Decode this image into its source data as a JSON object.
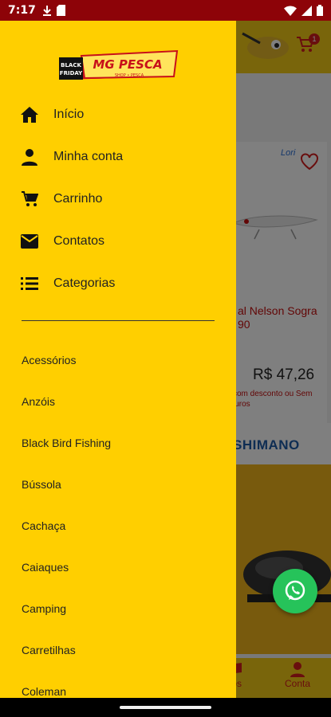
{
  "status_bar": {
    "time": "7:17"
  },
  "background_app": {
    "cart_badge": "1",
    "product": {
      "brand": "Lori",
      "name": "al Nelson Sogra 90",
      "price": "R$ 47,26",
      "price_note": "com desconto ou Sem juros"
    },
    "banner": {
      "brand": "SHIMANO"
    },
    "bottom_nav": {
      "contacts_label": "tos",
      "account_label": "Conta"
    }
  },
  "drawer": {
    "logo": {
      "line1": "BLACK",
      "line2": "FRIDAY",
      "brand": "MG PESCA",
      "tagline": "SHOP • PESCA"
    },
    "menu": [
      {
        "label": "Início",
        "icon": "home-icon"
      },
      {
        "label": "Minha conta",
        "icon": "person-icon"
      },
      {
        "label": "Carrinho",
        "icon": "cart-icon"
      },
      {
        "label": "Contatos",
        "icon": "mail-icon"
      },
      {
        "label": "Categorias",
        "icon": "list-icon"
      }
    ],
    "categories": [
      "Acessórios",
      "Anzóis",
      "Black Bird Fishing",
      "Bússola",
      "Cachaça",
      "Caiaques",
      "Camping",
      "Carretilhas",
      "Coleman"
    ]
  },
  "colors": {
    "drawer_bg": "#ffcf00",
    "status_bar": "#8d0308",
    "accent_red": "#d31c1c",
    "whatsapp": "#26c35a"
  }
}
